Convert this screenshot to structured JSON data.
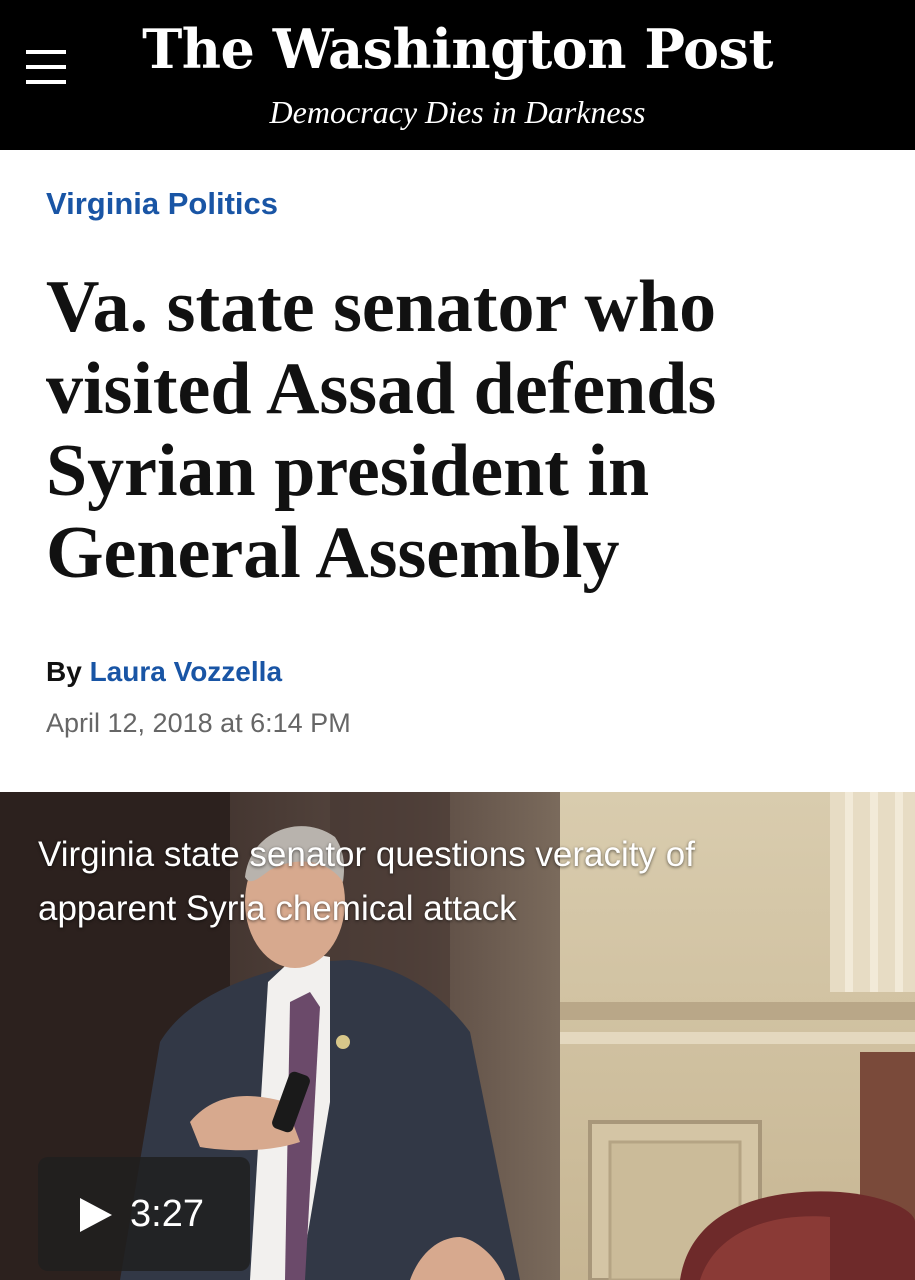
{
  "header": {
    "logo": "The Washington Post",
    "tagline": "Democracy Dies in Darkness",
    "menu_icon": "hamburger-menu-icon",
    "background_color": "#000000"
  },
  "article": {
    "section": "Virginia Politics",
    "headline": "Va. state senator who visited Assad defends Syrian president in General Assembly",
    "byline_prefix": "By",
    "author": "Laura Vozzella",
    "timestamp": "April 12, 2018 at 6:14 PM",
    "link_color": "#1955a5"
  },
  "video": {
    "caption": "Virginia state senator questions veracity of apparent Syria chemical attack",
    "duration": "3:27",
    "play_icon": "play-icon"
  }
}
